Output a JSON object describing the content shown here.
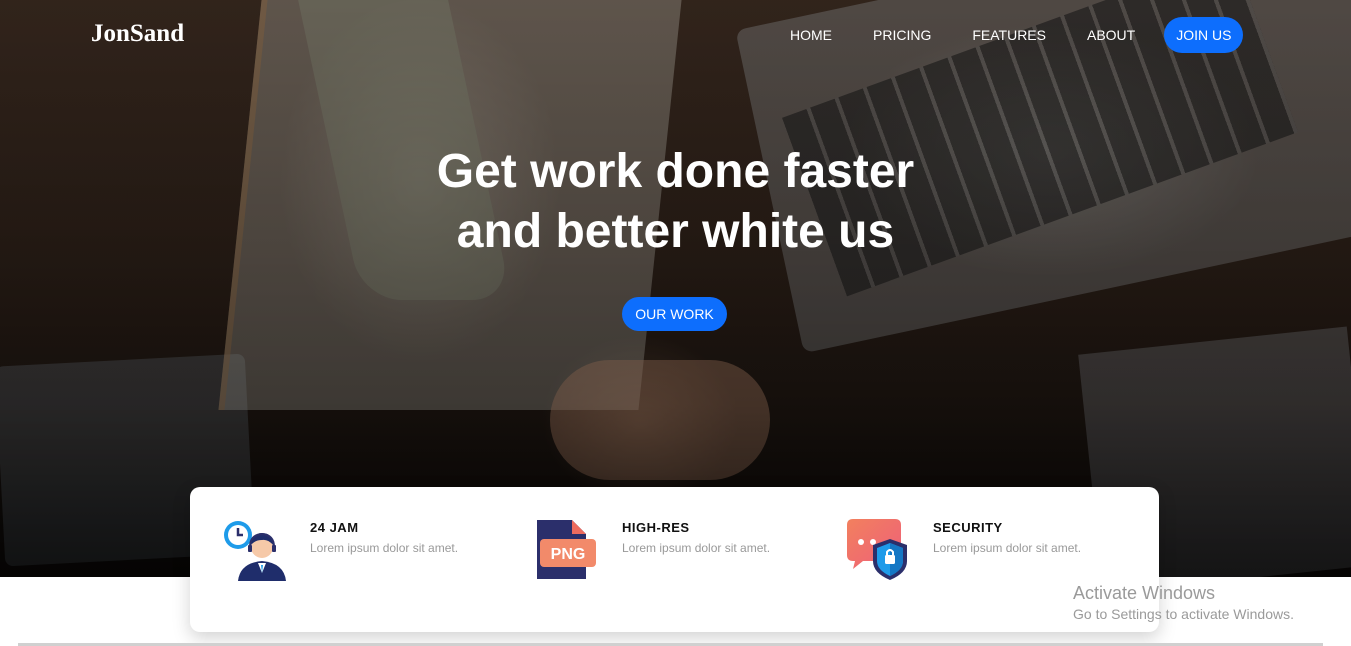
{
  "brand": {
    "logo": "JonSand"
  },
  "nav": {
    "items": [
      "HOME",
      "PRICING",
      "FEATURES",
      "ABOUT"
    ],
    "join": "JOIN US"
  },
  "hero": {
    "line1_regular": "Get work done ",
    "line1_bold": "faster",
    "line2_regular_a": "and ",
    "line2_bold": "better",
    "line2_regular_b": " white us",
    "cta": "OUR WORK"
  },
  "features": [
    {
      "title": "24 JAM",
      "desc": "Lorem ipsum dolor sit amet.",
      "icon": "support-agent-clock-icon"
    },
    {
      "title": "HIGH-RES",
      "desc": "Lorem ipsum dolor sit amet.",
      "icon": "png-file-icon",
      "icon_text": "PNG"
    },
    {
      "title": "SECURITY",
      "desc": "Lorem ipsum dolor sit amet.",
      "icon": "shield-chat-icon"
    }
  ],
  "watermark": {
    "title": "Activate Windows",
    "subtitle": "Go to Settings to activate Windows."
  },
  "colors": {
    "accent": "#0d6efd",
    "muted_text": "#999999"
  }
}
